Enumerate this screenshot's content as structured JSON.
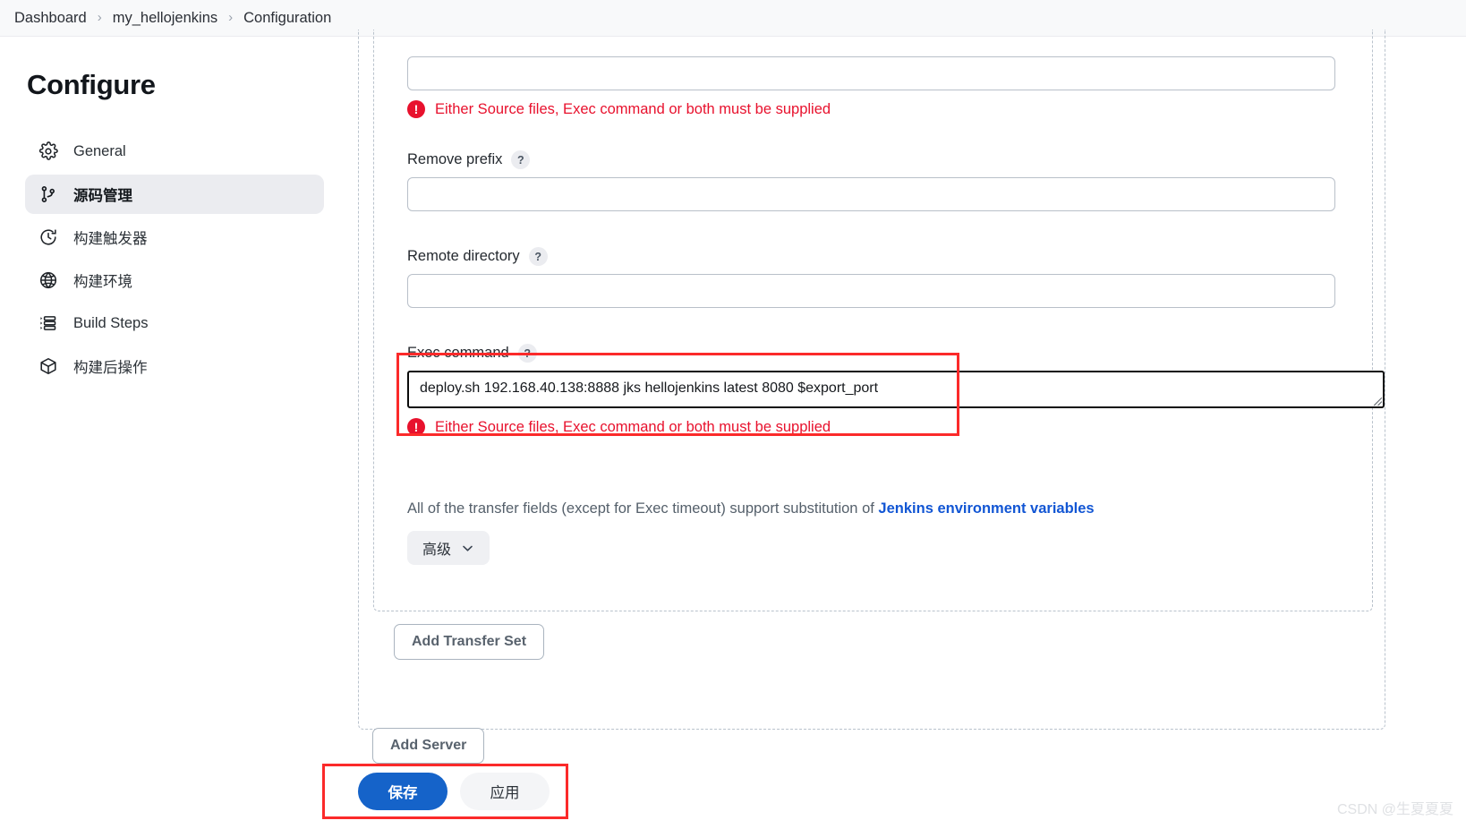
{
  "breadcrumb": {
    "items": [
      {
        "label": "Dashboard"
      },
      {
        "label": "my_hellojenkins"
      },
      {
        "label": "Configuration"
      }
    ],
    "separator": "›"
  },
  "sidebar": {
    "title": "Configure",
    "items": [
      {
        "label": "General",
        "icon": "gear-icon",
        "active": false
      },
      {
        "label": "源码管理",
        "icon": "branch-icon",
        "active": true
      },
      {
        "label": "构建触发器",
        "icon": "clock-icon",
        "active": false
      },
      {
        "label": "构建环境",
        "icon": "globe-icon",
        "active": false
      },
      {
        "label": "Build Steps",
        "icon": "list-icon",
        "active": false
      },
      {
        "label": "构建后操作",
        "icon": "package-icon",
        "active": false
      }
    ]
  },
  "form": {
    "source_files": {
      "value": "",
      "error": "Either Source files, Exec command or both must be supplied"
    },
    "remove_prefix": {
      "label": "Remove prefix",
      "help": "?",
      "value": ""
    },
    "remote_directory": {
      "label": "Remote directory",
      "help": "?",
      "value": ""
    },
    "exec_command": {
      "label": "Exec command",
      "help": "?",
      "value": "deploy.sh 192.168.40.138:8888 jks hellojenkins latest 8080 $export_port",
      "error": "Either Source files, Exec command or both must be supplied"
    },
    "substitution_note": {
      "text": "All of the transfer fields (except for Exec timeout) support substitution of ",
      "link": "Jenkins environment variables"
    },
    "advanced_button": "高级",
    "add_transfer_set_button": "Add Transfer Set",
    "add_server_button": "Add Server"
  },
  "footer": {
    "save_label": "保存",
    "apply_label": "应用"
  },
  "watermark": "CSDN @生夏夏夏",
  "colors": {
    "accent": "#1563c9",
    "error": "#e8112d",
    "annotation": "#fb2a2a",
    "link": "#1256d4"
  }
}
